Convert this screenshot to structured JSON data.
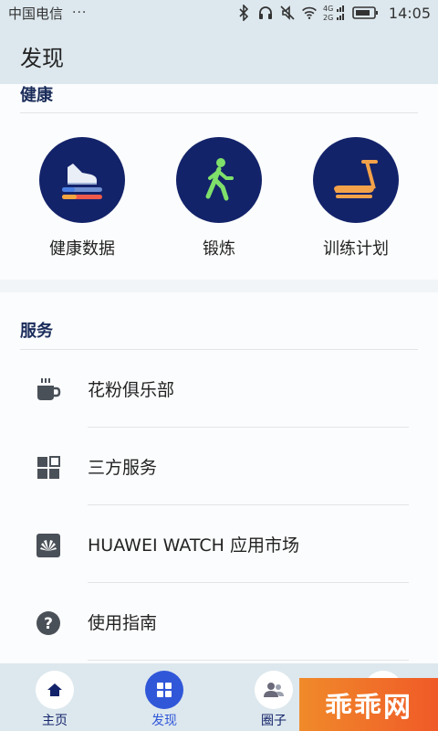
{
  "status_bar": {
    "carrier": "中国电信",
    "dots": "···",
    "time": "14:05",
    "net_top": "4G",
    "net_bottom": "2G"
  },
  "app_bar": {
    "title": "发现"
  },
  "health": {
    "title": "健康",
    "items": [
      {
        "label": "健康数据",
        "icon": "shoe-icon"
      },
      {
        "label": "锻炼",
        "icon": "walking-person-icon"
      },
      {
        "label": "训练计划",
        "icon": "treadmill-icon"
      }
    ]
  },
  "services": {
    "title": "服务",
    "items": [
      {
        "label": "花粉俱乐部",
        "icon": "coffee-cup-icon"
      },
      {
        "label": "三方服务",
        "icon": "grid-apps-icon"
      },
      {
        "label": "HUAWEI WATCH 应用市场",
        "icon": "huawei-logo-icon"
      },
      {
        "label": "使用指南",
        "icon": "help-question-icon"
      }
    ]
  },
  "tab_bar": {
    "tabs": [
      {
        "label": "主页",
        "icon": "home-icon",
        "active": false
      },
      {
        "label": "发现",
        "icon": "discover-grid-icon",
        "active": true
      },
      {
        "label": "圈子",
        "icon": "friends-icon",
        "active": false
      }
    ]
  },
  "watermark": {
    "text": "乖乖网"
  },
  "colors": {
    "navy": "#13236a",
    "accent_blue": "#3157d9",
    "bar_bg": "#dde8ee",
    "walker_green": "#7ee06a",
    "treadmill_orange": "#f3a24a"
  }
}
